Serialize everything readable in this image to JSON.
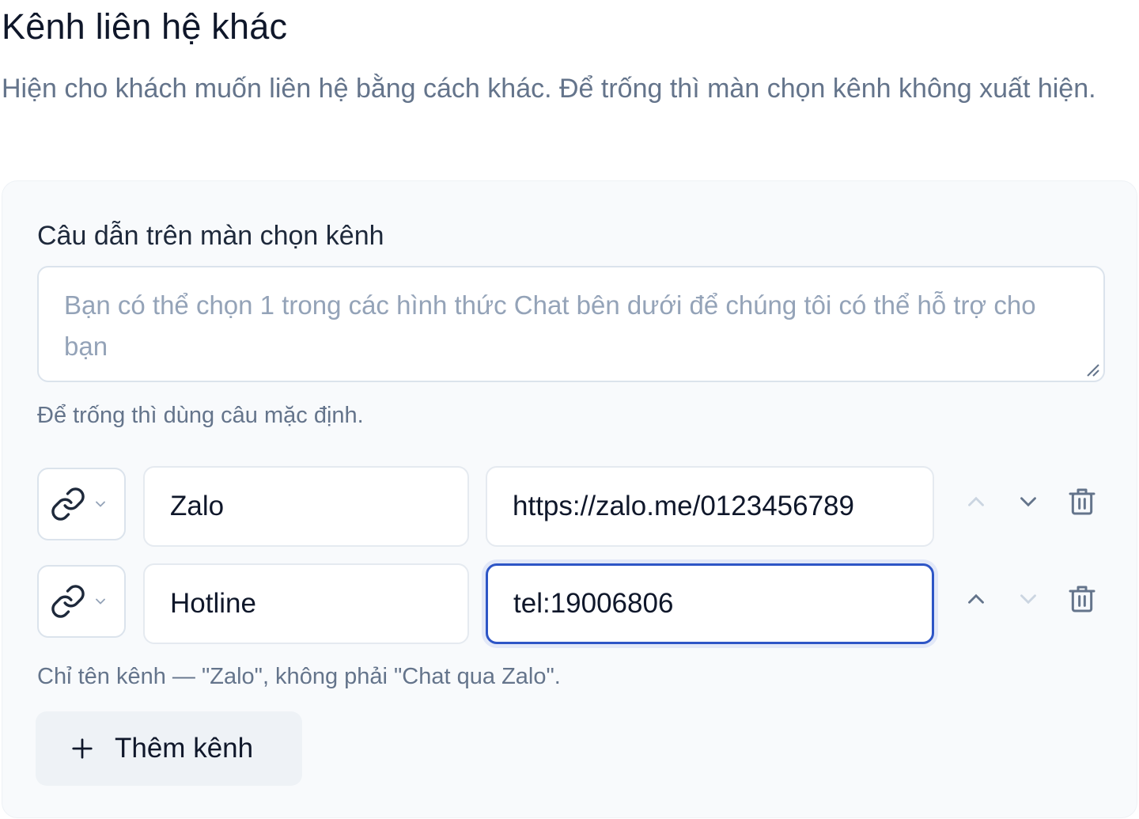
{
  "section": {
    "title": "Kênh liên hệ khác",
    "description": "Hiện cho khách muốn liên hệ bằng cách khác. Để trống thì màn chọn kênh không xuất hiện."
  },
  "prompt_field": {
    "label": "Câu dẫn trên màn chọn kênh",
    "placeholder": "Bạn có thể chọn 1 trong các hình thức Chat bên dưới để chúng tôi có thể hỗ trợ cho bạn",
    "value": "",
    "hint": "Để trống thì dùng câu mặc định."
  },
  "channels": [
    {
      "icon": "link-icon",
      "name": "Zalo",
      "url": "https://zalo.me/0123456789",
      "up_enabled": false,
      "down_enabled": true,
      "focused": false
    },
    {
      "icon": "link-icon",
      "name": "Hotline",
      "url": "tel:19006806",
      "up_enabled": true,
      "down_enabled": false,
      "focused": true
    }
  ],
  "channels_hint": "Chỉ tên kênh — \"Zalo\", không phải \"Chat qua Zalo\".",
  "add_button": {
    "icon": "plus-icon",
    "label": "Thêm kênh"
  },
  "colors": {
    "text": "#0f172a",
    "muted": "#64748b",
    "placeholder": "#94a3b8",
    "card_bg": "#f8fafc",
    "focus_border": "#2d55c6",
    "disabled_icon": "#cbd5e1",
    "active_icon": "#64748b"
  }
}
